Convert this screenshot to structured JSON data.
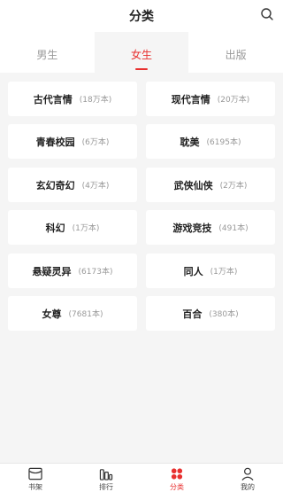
{
  "header": {
    "title": "分类",
    "search_icon": "search-icon"
  },
  "tabs": [
    {
      "label": "男生",
      "active": false
    },
    {
      "label": "女生",
      "active": true
    },
    {
      "label": "出版",
      "active": false
    }
  ],
  "categories": [
    {
      "name": "古代言情",
      "count": "(18万本)"
    },
    {
      "name": "现代言情",
      "count": "(20万本)"
    },
    {
      "name": "青春校园",
      "count": "(6万本)"
    },
    {
      "name": "耽美",
      "count": "(6195本)"
    },
    {
      "name": "玄幻奇幻",
      "count": "(4万本)"
    },
    {
      "name": "武侠仙侠",
      "count": "(2万本)"
    },
    {
      "name": "科幻",
      "count": "(1万本)"
    },
    {
      "name": "游戏竞技",
      "count": "(491本)"
    },
    {
      "name": "悬疑灵异",
      "count": "(6173本)"
    },
    {
      "name": "同人",
      "count": "(1万本)"
    },
    {
      "name": "女尊",
      "count": "(7681本)"
    },
    {
      "name": "百合",
      "count": "(380本)"
    }
  ],
  "tabbar": [
    {
      "label": "书架",
      "icon": "bookshelf-icon",
      "active": false
    },
    {
      "label": "排行",
      "icon": "ranking-icon",
      "active": false
    },
    {
      "label": "分类",
      "icon": "category-icon",
      "active": true
    },
    {
      "label": "我的",
      "icon": "profile-icon",
      "active": false
    }
  ],
  "colors": {
    "accent": "#e8302f",
    "background": "#f5f5f5",
    "muted": "#999999"
  }
}
